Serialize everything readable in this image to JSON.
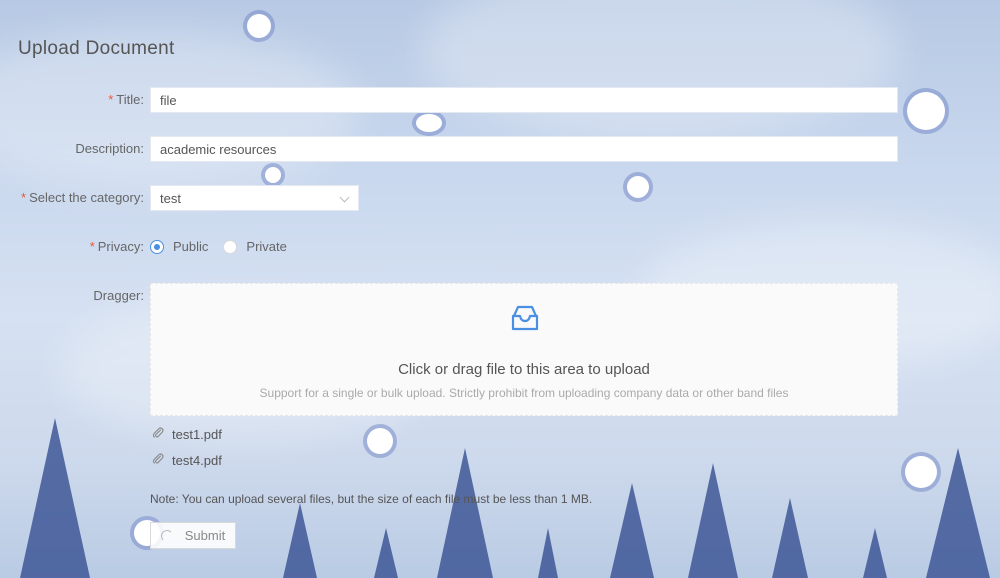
{
  "page": {
    "title": "Upload Document"
  },
  "form": {
    "title": {
      "label": "Title",
      "value": "file",
      "required": true
    },
    "description": {
      "label": "Description",
      "value": "academic resources",
      "required": false
    },
    "category": {
      "label": "Select the category",
      "value": "test",
      "required": true
    },
    "privacy": {
      "label": "Privacy",
      "required": true,
      "options": [
        {
          "label": "Public",
          "checked": true
        },
        {
          "label": "Private",
          "checked": false
        }
      ]
    },
    "dragger": {
      "label": "Dragger",
      "text": "Click or drag file to this area to upload",
      "hint": "Support for a single or bulk upload. Strictly prohibit from uploading company data or other band files",
      "icon": "inbox-icon"
    },
    "files": [
      "test1.pdf",
      "test4.pdf"
    ],
    "note": "Note: You can upload several files, but the size of each file must be less than 1 MB.",
    "submit_label": "Submit"
  },
  "colors": {
    "accent": "#4a90e2",
    "required": "#e6583f",
    "tree": "#3e5796"
  }
}
